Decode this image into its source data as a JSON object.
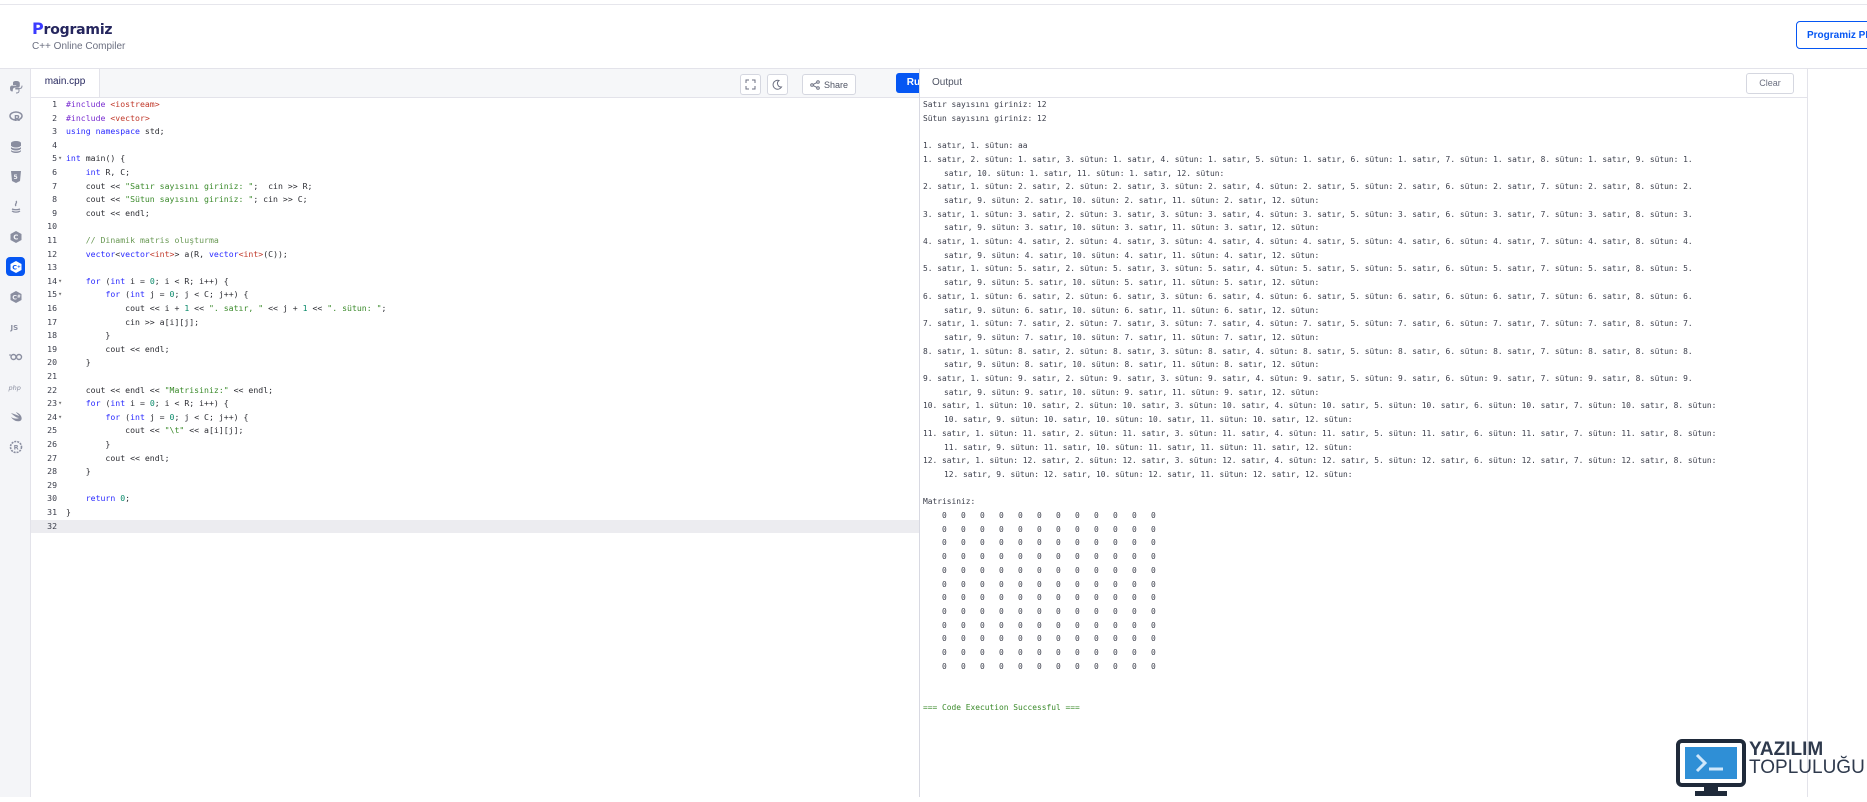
{
  "header": {
    "logo_text": "rogramiz",
    "logo_initial": "P",
    "subtitle": "C++ Online Compiler",
    "pro_button": "Programiz PRO"
  },
  "sidebar": {
    "items": [
      {
        "icon": "python-icon"
      },
      {
        "icon": "r-icon"
      },
      {
        "icon": "sql-icon"
      },
      {
        "icon": "html5-icon"
      },
      {
        "icon": "java-icon"
      },
      {
        "icon": "c-icon"
      },
      {
        "icon": "cpp-icon",
        "active": true
      },
      {
        "icon": "csharp-icon"
      },
      {
        "icon": "js-icon",
        "label": "JS"
      },
      {
        "icon": "go-icon",
        "label": "GO"
      },
      {
        "icon": "php-icon",
        "label": "php"
      },
      {
        "icon": "swift-icon"
      },
      {
        "icon": "rust-icon"
      }
    ]
  },
  "editor": {
    "tab_label": "main.cpp",
    "share_label": "Share",
    "run_label": "Run",
    "lines": [
      "#include <iostream>",
      "#include <vector>",
      "using namespace std;",
      "",
      "int main() {",
      "    int R, C;",
      "    cout << \"Satır sayısını giriniz: \";  cin >> R;",
      "    cout << \"Sütun sayısını giriniz: \"; cin >> C;",
      "    cout << endl;",
      "",
      "    // Dinamik matris oluşturma",
      "    vector<vector<int>> a(R, vector<int>(C));",
      "",
      "    for (int i = 0; i < R; i++) {",
      "        for (int j = 0; j < C; j++) {",
      "            cout << i + 1 << \". satır, \" << j + 1 << \". sütun: \";",
      "            cin >> a[i][j];",
      "        }",
      "        cout << endl;",
      "    }",
      "",
      "    cout << endl << \"Matrisiniz:\" << endl;",
      "    for (int i = 0; i < R; i++) {",
      "        for (int j = 0; j < C; j++) {",
      "            cout << \"\\t\" << a[i][j];",
      "        }",
      "        cout << endl;",
      "    }",
      "",
      "    return 0;",
      "}",
      ""
    ]
  },
  "output": {
    "title": "Output",
    "clear_label": "Clear",
    "lines": [
      {
        "t": "Satır sayısını giriniz: 12"
      },
      {
        "t": "Sütun sayısını giriniz: 12"
      },
      {
        "t": ""
      },
      {
        "t": "1. satır, 1. sütun: aa"
      },
      {
        "t": "1. satır, 2. sütun: 1. satır, 3. sütun: 1. satır, 4. sütun: 1. satır, 5. sütun: 1. satır, 6. sütun: 1. satır, 7. sütun: 1. satır, 8. sütun: 1. satır, 9. sütun: 1."
      },
      {
        "t": "satır, 10. sütun: 1. satır, 11. sütun: 1. satır, 12. sütun:",
        "ind": true
      },
      {
        "t": "2. satır, 1. sütun: 2. satır, 2. sütun: 2. satır, 3. sütun: 2. satır, 4. sütun: 2. satır, 5. sütun: 2. satır, 6. sütun: 2. satır, 7. sütun: 2. satır, 8. sütun: 2."
      },
      {
        "t": "satır, 9. sütun: 2. satır, 10. sütun: 2. satır, 11. sütun: 2. satır, 12. sütun:",
        "ind": true
      },
      {
        "t": "3. satır, 1. sütun: 3. satır, 2. sütun: 3. satır, 3. sütun: 3. satır, 4. sütun: 3. satır, 5. sütun: 3. satır, 6. sütun: 3. satır, 7. sütun: 3. satır, 8. sütun: 3."
      },
      {
        "t": "satır, 9. sütun: 3. satır, 10. sütun: 3. satır, 11. sütun: 3. satır, 12. sütun:",
        "ind": true
      },
      {
        "t": "4. satır, 1. sütun: 4. satır, 2. sütun: 4. satır, 3. sütun: 4. satır, 4. sütun: 4. satır, 5. sütun: 4. satır, 6. sütun: 4. satır, 7. sütun: 4. satır, 8. sütun: 4."
      },
      {
        "t": "satır, 9. sütun: 4. satır, 10. sütun: 4. satır, 11. sütun: 4. satır, 12. sütun:",
        "ind": true
      },
      {
        "t": "5. satır, 1. sütun: 5. satır, 2. sütun: 5. satır, 3. sütun: 5. satır, 4. sütun: 5. satır, 5. sütun: 5. satır, 6. sütun: 5. satır, 7. sütun: 5. satır, 8. sütun: 5."
      },
      {
        "t": "satır, 9. sütun: 5. satır, 10. sütun: 5. satır, 11. sütun: 5. satır, 12. sütun:",
        "ind": true
      },
      {
        "t": "6. satır, 1. sütun: 6. satır, 2. sütun: 6. satır, 3. sütun: 6. satır, 4. sütun: 6. satır, 5. sütun: 6. satır, 6. sütun: 6. satır, 7. sütun: 6. satır, 8. sütun: 6."
      },
      {
        "t": "satır, 9. sütun: 6. satır, 10. sütun: 6. satır, 11. sütun: 6. satır, 12. sütun:",
        "ind": true
      },
      {
        "t": "7. satır, 1. sütun: 7. satır, 2. sütun: 7. satır, 3. sütun: 7. satır, 4. sütun: 7. satır, 5. sütun: 7. satır, 6. sütun: 7. satır, 7. sütun: 7. satır, 8. sütun: 7."
      },
      {
        "t": "satır, 9. sütun: 7. satır, 10. sütun: 7. satır, 11. sütun: 7. satır, 12. sütun:",
        "ind": true
      },
      {
        "t": "8. satır, 1. sütun: 8. satır, 2. sütun: 8. satır, 3. sütun: 8. satır, 4. sütun: 8. satır, 5. sütun: 8. satır, 6. sütun: 8. satır, 7. sütun: 8. satır, 8. sütun: 8."
      },
      {
        "t": "satır, 9. sütun: 8. satır, 10. sütun: 8. satır, 11. sütun: 8. satır, 12. sütun:",
        "ind": true
      },
      {
        "t": "9. satır, 1. sütun: 9. satır, 2. sütun: 9. satır, 3. sütun: 9. satır, 4. sütun: 9. satır, 5. sütun: 9. satır, 6. sütun: 9. satır, 7. sütun: 9. satır, 8. sütun: 9."
      },
      {
        "t": "satır, 9. sütun: 9. satır, 10. sütun: 9. satır, 11. sütun: 9. satır, 12. sütun:",
        "ind": true
      },
      {
        "t": "10. satır, 1. sütun: 10. satır, 2. sütun: 10. satır, 3. sütun: 10. satır, 4. sütun: 10. satır, 5. sütun: 10. satır, 6. sütun: 10. satır, 7. sütun: 10. satır, 8. sütun:"
      },
      {
        "t": "10. satır, 9. sütun: 10. satır, 10. sütun: 10. satır, 11. sütun: 10. satır, 12. sütun:",
        "ind": true
      },
      {
        "t": "11. satır, 1. sütun: 11. satır, 2. sütun: 11. satır, 3. sütun: 11. satır, 4. sütun: 11. satır, 5. sütun: 11. satır, 6. sütun: 11. satır, 7. sütun: 11. satır, 8. sütun:"
      },
      {
        "t": "11. satır, 9. sütun: 11. satır, 10. sütun: 11. satır, 11. sütun: 11. satır, 12. sütun:",
        "ind": true
      },
      {
        "t": "12. satır, 1. sütun: 12. satır, 2. sütun: 12. satır, 3. sütun: 12. satır, 4. sütun: 12. satır, 5. sütun: 12. satır, 6. sütun: 12. satır, 7. sütun: 12. satır, 8. sütun:"
      },
      {
        "t": "12. satır, 9. sütun: 12. satır, 10. sütun: 12. satır, 11. sütun: 12. satır, 12. sütun:",
        "ind": true
      },
      {
        "t": ""
      },
      {
        "t": "Matrisiniz:"
      },
      {
        "t": "    0   0   0   0   0   0   0   0   0   0   0   0"
      },
      {
        "t": "    0   0   0   0   0   0   0   0   0   0   0   0"
      },
      {
        "t": "    0   0   0   0   0   0   0   0   0   0   0   0"
      },
      {
        "t": "    0   0   0   0   0   0   0   0   0   0   0   0"
      },
      {
        "t": "    0   0   0   0   0   0   0   0   0   0   0   0"
      },
      {
        "t": "    0   0   0   0   0   0   0   0   0   0   0   0"
      },
      {
        "t": "    0   0   0   0   0   0   0   0   0   0   0   0"
      },
      {
        "t": "    0   0   0   0   0   0   0   0   0   0   0   0"
      },
      {
        "t": "    0   0   0   0   0   0   0   0   0   0   0   0"
      },
      {
        "t": "    0   0   0   0   0   0   0   0   0   0   0   0"
      },
      {
        "t": "    0   0   0   0   0   0   0   0   0   0   0   0"
      },
      {
        "t": "    0   0   0   0   0   0   0   0   0   0   0   0"
      },
      {
        "t": ""
      },
      {
        "t": ""
      },
      {
        "t": "=== Code Execution Successful ===",
        "ok": true
      }
    ]
  },
  "watermark": {
    "line1": "YAZILIM",
    "line2": "TOPLULUĞU"
  },
  "colors": {
    "accent": "#0556f3",
    "text": "#25265e"
  }
}
